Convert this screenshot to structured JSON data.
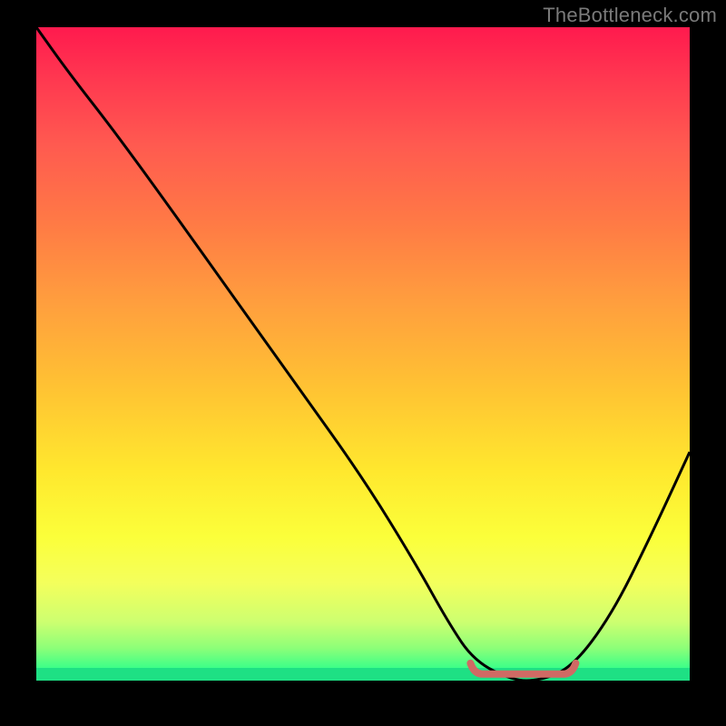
{
  "watermark": "TheBottleneck.com",
  "chart_data": {
    "type": "line",
    "title": "",
    "xlabel": "",
    "ylabel": "",
    "xlim": [
      0,
      100
    ],
    "ylim": [
      0,
      100
    ],
    "series": [
      {
        "name": "bottleneck-curve",
        "x": [
          0,
          5,
          12,
          20,
          30,
          40,
          50,
          58,
          63,
          67,
          73,
          77,
          82,
          88,
          94,
          100
        ],
        "values": [
          100,
          93,
          84,
          73,
          59,
          45,
          31,
          18,
          9,
          3,
          0,
          0,
          2,
          10,
          22,
          35
        ]
      }
    ],
    "annotations": [
      {
        "name": "optimal-segment",
        "x_start": 67,
        "x_end": 82,
        "value": 1,
        "color": "#d06a64",
        "thickness": 8
      }
    ],
    "background": {
      "type": "vertical-gradient",
      "stops": [
        {
          "pos": 0,
          "color": "#ff1a4e"
        },
        {
          "pos": 30,
          "color": "#ff7a45"
        },
        {
          "pos": 68,
          "color": "#ffe82e"
        },
        {
          "pos": 95,
          "color": "#8dff78"
        },
        {
          "pos": 100,
          "color": "#18e682"
        }
      ]
    }
  }
}
